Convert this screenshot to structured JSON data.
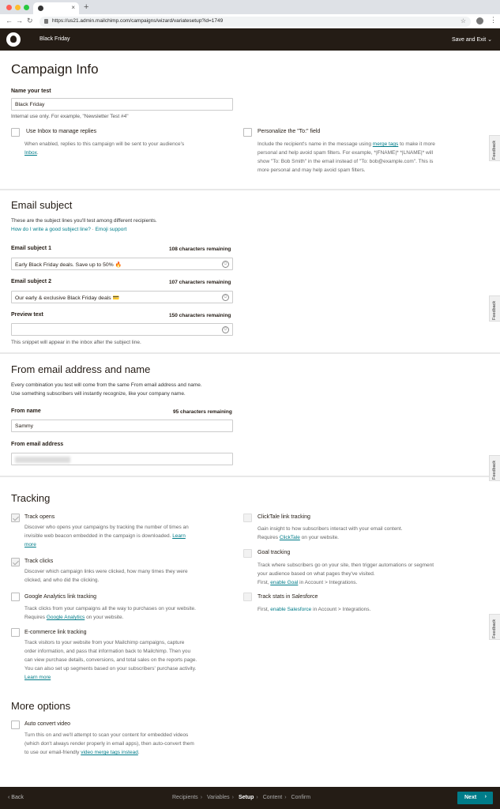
{
  "browser": {
    "url": "https://us21.admin.mailchimp.com/campaigns/wizard/variatesetup?id=1749",
    "new_tab": "+",
    "tab_close": "×"
  },
  "header": {
    "campaign_name": "Black Friday",
    "save_exit": "Save and Exit ⌄"
  },
  "campaign_info": {
    "title": "Campaign Info",
    "name_label": "Name your test",
    "name_value": "Black Friday",
    "name_help": "Internal use only. For example, \"Newsletter Test #4\"",
    "inbox_label": "Use Inbox to manage replies",
    "inbox_desc_1": "When enabled, replies to this campaign will be sent to your audience's",
    "inbox_link": "Inbox",
    "inbox_desc_end": ".",
    "personalize_label": "Personalize the \"To:\" field",
    "personalize_desc_1": "Include the recipient's name in the message using",
    "merge_tags_link": "merge tags",
    "personalize_desc_2": "to make it more",
    "personalize_desc_3": "personal and help avoid spam filters. For example, *|FNAME|* *|LNAME|* will",
    "personalize_desc_4": "show \"To: Bob Smith\" in the email instead of \"To: bob@example.com\". This is",
    "personalize_desc_5": "more personal and may help avoid spam filters."
  },
  "email_subject": {
    "title": "Email subject",
    "intro": "These are the subject lines you'll test among different recipients.",
    "help_link": "How do I write a good subject line?",
    "help_sep": " · ",
    "emoji_link": "Emoji support",
    "subject1_label": "Email subject 1",
    "subject1_remaining": "108 characters remaining",
    "subject1_value": "Early Black Friday deals. Save up to 50% 🔥",
    "subject2_label": "Email subject 2",
    "subject2_remaining": "107 characters remaining",
    "subject2_value": "Our early & exclusive Black Friday deals 💳",
    "preview_label": "Preview text",
    "preview_remaining": "150 characters remaining",
    "preview_value": "",
    "preview_help": "This snippet will appear in the inbox after the subject line.",
    "emoji_icon": "☺"
  },
  "from": {
    "title": "From email address and name",
    "intro_1": "Every combination you test will come from the same From email address and name.",
    "intro_2": "Use something subscribers will instantly recognize, like your company name.",
    "name_label": "From name",
    "name_remaining": "95 characters remaining",
    "name_value": "Sammy",
    "email_label": "From email address"
  },
  "tracking": {
    "title": "Tracking",
    "opens_label": "Track opens",
    "opens_desc_1": "Discover who opens your campaigns by tracking the number of times an",
    "opens_desc_2": "invisible web beacon embedded in the campaign is downloaded.",
    "learn_more_1": "Learn",
    "learn_more_2": "more",
    "clicks_label": "Track clicks",
    "clicks_desc_1": "Discover which campaign links were clicked, how many times they were",
    "clicks_desc_2": "clicked, and who did the clicking.",
    "ga_label": "Google Analytics link tracking",
    "ga_desc_1": "Track clicks from your campaigns all the way to purchases on your website.",
    "ga_desc_2": "Requires",
    "ga_link": "Google Analytics",
    "ga_desc_3": "on your website.",
    "ecom_label": "E-commerce link tracking",
    "ecom_desc_1": "Track visitors to your website from your Mailchimp campaigns, capture",
    "ecom_desc_2": "order information, and pass that information back to Mailchimp. Then you",
    "ecom_desc_3": "can view purchase details, conversions, and total sales on the reports page.",
    "ecom_desc_4": "You can also set up segments based on your subscribers' purchase activity.",
    "ecom_learn_more": "Learn more",
    "clicktale_label": "ClickTale link tracking",
    "clicktale_desc_1": "Gain insight to how subscribers interact with your email content.",
    "clicktale_desc_2": "Requires",
    "clicktale_link": "ClickTale",
    "clicktale_desc_3": "on your website.",
    "goal_label": "Goal tracking",
    "goal_desc_1": "Track where subscribers go on your site, then trigger automations or segment",
    "goal_desc_2": "your audience based on what pages they've visited.",
    "goal_desc_3": "First,",
    "goal_link": "enable Goal",
    "goal_desc_4": "in Account > Integrations.",
    "sf_label": "Track stats in Salesforce",
    "sf_desc_1": "First,",
    "sf_link": "enable Salesforce",
    "sf_desc_2": "in Account > Integrations."
  },
  "more_options": {
    "title": "More options",
    "video_label": "Auto convert video",
    "video_desc_1": "Turn this on and we'll attempt to scan your content for embedded videos",
    "video_desc_2": "(which don't always render properly in email apps), then auto-convert them",
    "video_desc_3": "to use our email-friendly",
    "video_link": "video merge tags instead",
    "video_desc_4": "."
  },
  "feedback_label": "Feedback",
  "footer": {
    "back": "‹  Back",
    "steps": [
      "Recipients",
      "Variables",
      "Setup",
      "Content",
      "Confirm"
    ],
    "step_sep": "›",
    "next": "Next",
    "next_arrow": "›"
  },
  "colors": {
    "accent": "#007c89",
    "header_bg": "#241c15"
  }
}
